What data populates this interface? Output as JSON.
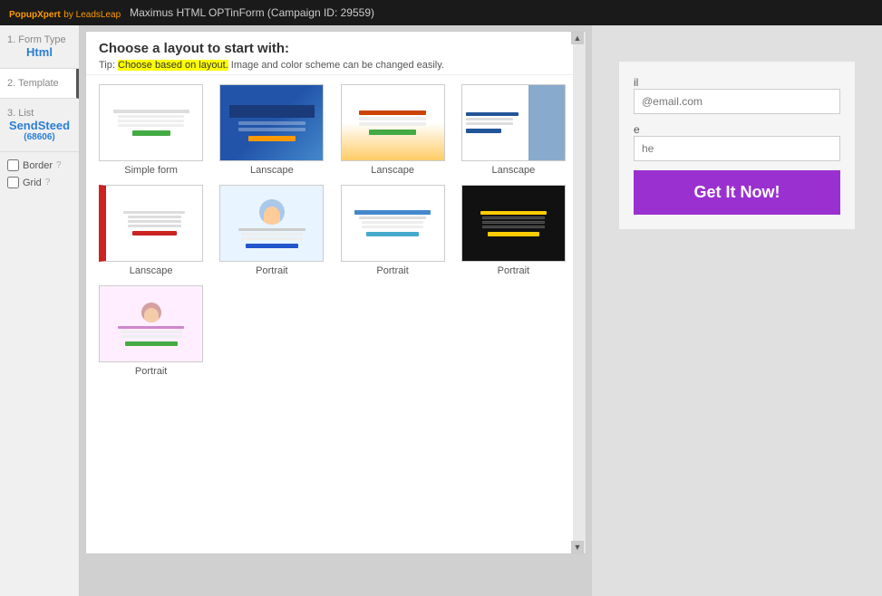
{
  "topbar": {
    "brand": "PopupXpert",
    "brand_sub": "by LeadsLeap",
    "title": "Maximus HTML OPTinForm (Campaign ID: 29559)"
  },
  "sidebar": {
    "steps": [
      {
        "id": "form-type",
        "step": "1. Form Type",
        "value": "Html"
      },
      {
        "id": "template",
        "step": "2. Template",
        "value": ""
      },
      {
        "id": "list",
        "step": "3. List",
        "value": "SendSteed",
        "sub": "(68606)"
      }
    ],
    "checkboxes": [
      {
        "id": "border",
        "label": "Border",
        "checked": false
      },
      {
        "id": "grid",
        "label": "Grid",
        "checked": false
      }
    ]
  },
  "layout_panel": {
    "title": "Choose a layout to start with:",
    "tip_prefix": "Tip: ",
    "tip_highlight": "Choose based on layout.",
    "tip_suffix": " Image and color scheme can be changed easily.",
    "templates": [
      {
        "id": "simple-form",
        "label": "Simple form",
        "style": "simple"
      },
      {
        "id": "lanscape-1",
        "label": "Lanscape",
        "style": "landscape-blue"
      },
      {
        "id": "lanscape-2",
        "label": "Lanscape",
        "style": "landscape-orange"
      },
      {
        "id": "lanscape-3",
        "label": "Lanscape",
        "style": "landscape-dark"
      },
      {
        "id": "lanscape-4",
        "label": "Lanscape",
        "style": "portrait-left"
      },
      {
        "id": "portrait-1",
        "label": "Portrait",
        "style": "portrait-cartoon"
      },
      {
        "id": "portrait-2",
        "label": "Portrait",
        "style": "portrait-help"
      },
      {
        "id": "portrait-3",
        "label": "Portrait",
        "style": "portrait-black"
      },
      {
        "id": "portrait-4",
        "label": "Portrait",
        "style": "portrait-lady"
      }
    ]
  },
  "preview": {
    "email_label": "il",
    "email_placeholder": "@email.com",
    "name_label": "e",
    "name_placeholder": "he",
    "submit_label": "Get It Now!"
  }
}
